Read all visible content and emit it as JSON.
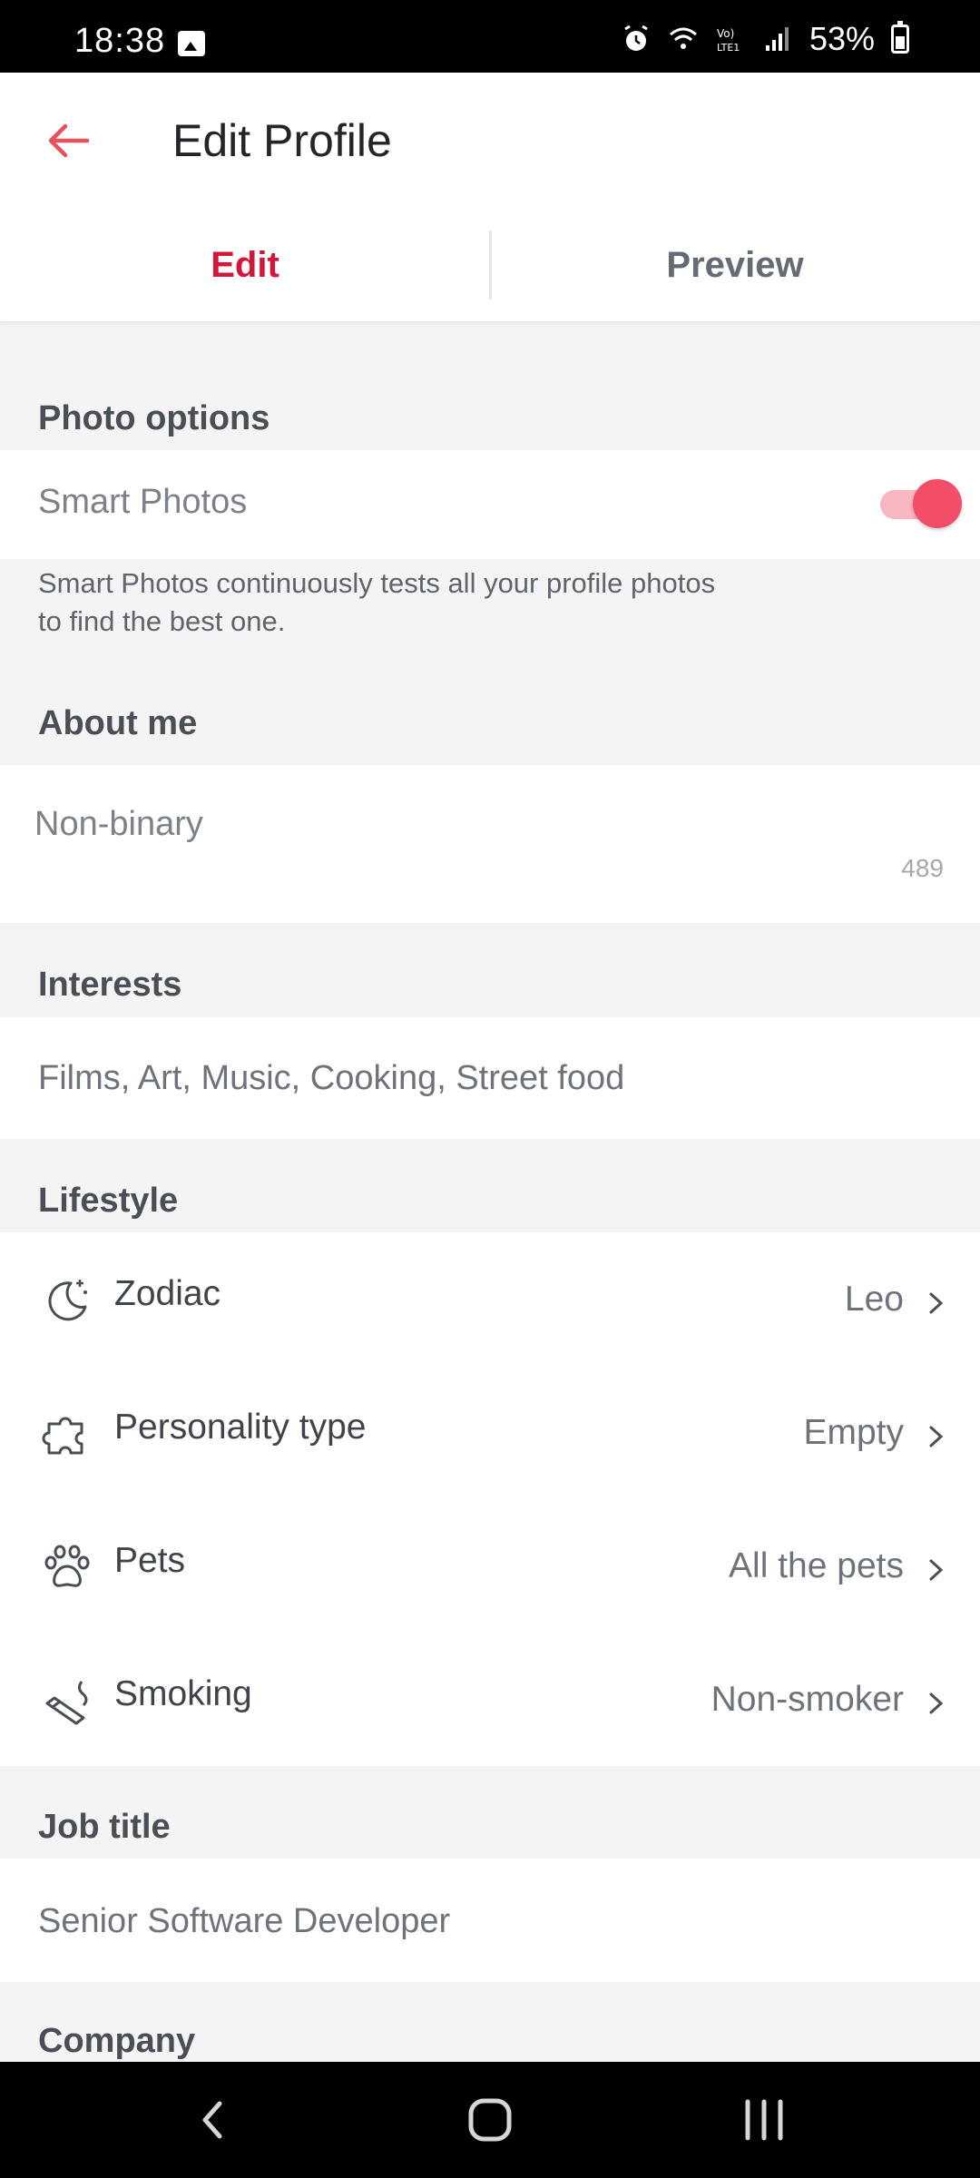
{
  "status_bar": {
    "time": "18:38",
    "battery": "53%"
  },
  "header": {
    "title": "Edit Profile"
  },
  "tabs": {
    "edit": "Edit",
    "preview": "Preview"
  },
  "photo_options": {
    "section_title": "Photo options",
    "smart_photos_label": "Smart Photos",
    "smart_photos_enabled": true,
    "help_text": "Smart Photos continuously tests all your profile photos to find the best one."
  },
  "about_me": {
    "section_title": "About me",
    "text": "Non-binary",
    "char_count": "489"
  },
  "interests": {
    "section_title": "Interests",
    "value": "Films, Art, Music, Cooking, Street food"
  },
  "lifestyle": {
    "section_title": "Lifestyle",
    "items": [
      {
        "label": "Zodiac",
        "value": "Leo",
        "icon": "moon-stars-icon"
      },
      {
        "label": "Personality type",
        "value": "Empty",
        "icon": "puzzle-icon"
      },
      {
        "label": "Pets",
        "value": "All the pets",
        "icon": "paw-icon"
      },
      {
        "label": "Smoking",
        "value": "Non-smoker",
        "icon": "cigarette-icon"
      }
    ]
  },
  "job_title": {
    "section_title": "Job title",
    "value": "Senior Software Developer"
  },
  "company": {
    "section_title": "Company"
  },
  "colors": {
    "accent": "#d2163c",
    "toggle": "#f24e68",
    "background": "#f4f4f5"
  }
}
